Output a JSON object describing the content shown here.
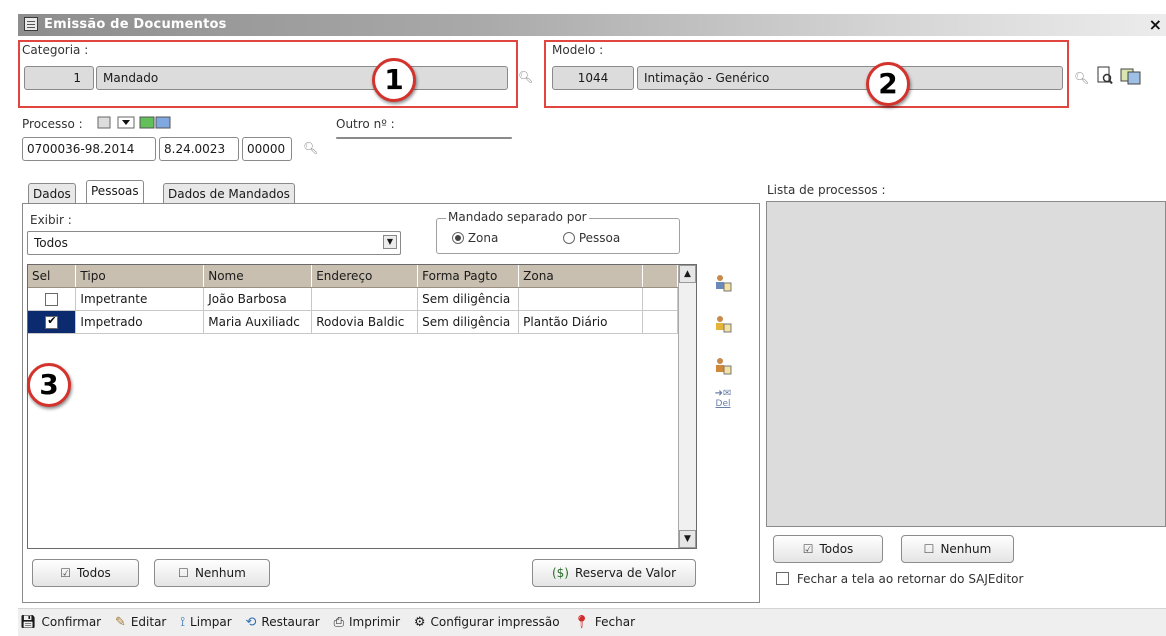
{
  "window": {
    "title": "Emissão de Documentos",
    "close_glyph": "×"
  },
  "categoria": {
    "label": "Categoria :",
    "code": "1",
    "name": "Mandado",
    "annotation": "1"
  },
  "modelo": {
    "label": "Modelo :",
    "code": "1044",
    "name": "Intimação - Genérico",
    "annotation": "2"
  },
  "processo": {
    "label": "Processo :",
    "part1": "0700036-98.2014",
    "part2": "8.24.0023",
    "part3": "00000",
    "outro_label": "Outro nº :",
    "outro_value": ""
  },
  "tabs": [
    {
      "label": "Dados"
    },
    {
      "label": "Pessoas"
    },
    {
      "label": "Dados de Mandados"
    }
  ],
  "exibir": {
    "label": "Exibir :",
    "value": "Todos"
  },
  "mandado_separado": {
    "label": "Mandado separado por",
    "option1": "Zona",
    "option2": "Pessoa",
    "selected": "Zona"
  },
  "grid": {
    "columns": [
      "Sel",
      "Tipo",
      "Nome",
      "Endereço",
      "Forma Pagto",
      "Zona"
    ],
    "rows": [
      {
        "sel": false,
        "tipo": "Impetrante",
        "nome": "João Barbosa",
        "endereco": "",
        "forma_pagto": "Sem diligência",
        "zona": ""
      },
      {
        "sel": true,
        "tipo": "Impetrado",
        "nome": "Maria Auxiliadc",
        "endereco": "Rodovia Baldic",
        "forma_pagto": "Sem diligência",
        "zona": "Plantão Diário"
      }
    ],
    "annotation": "3"
  },
  "side_icons": {
    "del_label": "Del"
  },
  "left_buttons": {
    "todos": "Todos",
    "nenhum": "Nenhum",
    "reserva": "Reserva de Valor"
  },
  "lista": {
    "label": "Lista de processos :",
    "todos": "Todos",
    "nenhum": "Nenhum",
    "fechar_label": "Fechar a tela ao retornar do SAJEditor"
  },
  "toolbar": {
    "confirmar": "Confirmar",
    "editar": "Editar",
    "limpar": "Limpar",
    "restaurar": "Restaurar",
    "imprimir": "Imprimir",
    "configurar": "Configurar impressão",
    "fechar": "Fechar"
  },
  "colors": {
    "annotation_red": "#e0453f",
    "grid_header": "#c9bfb0",
    "selected_cell": "#0c2a6e"
  }
}
